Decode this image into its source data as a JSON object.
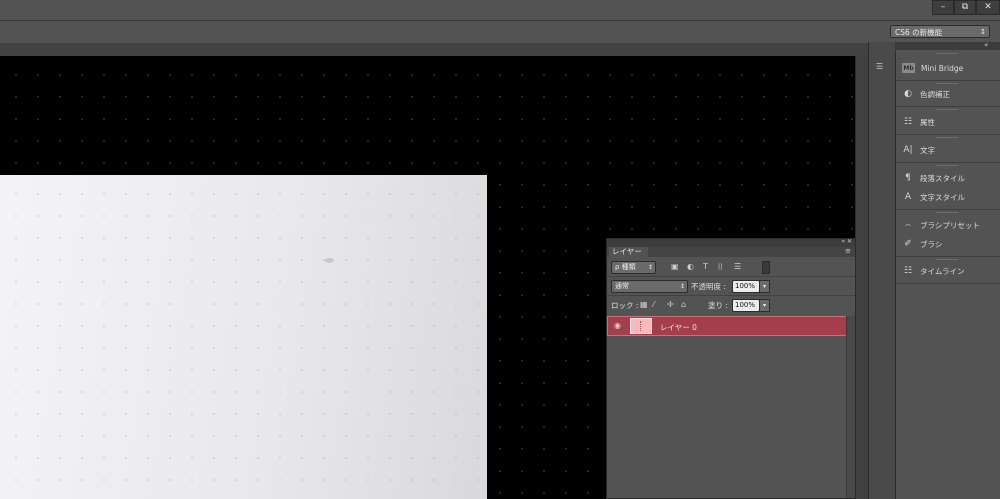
{
  "window": {
    "minimize_label": "–",
    "restore_label": "⧉",
    "close_label": "✕"
  },
  "workspace": {
    "selected": "CS6 の新機能",
    "arrow": "↕"
  },
  "dock": {
    "expand_arrows": "«",
    "history_icon": "history-icon"
  },
  "right_panel": {
    "items": [
      {
        "label": "Mini Bridge",
        "icon": "Mb"
      },
      {
        "label": "色調補正",
        "icon": "◐"
      },
      {
        "label": "属性",
        "icon": "☷"
      },
      {
        "label": "文字",
        "icon": "A|"
      },
      {
        "label": "段落スタイル",
        "icon": "¶"
      },
      {
        "label": "文字スタイル",
        "icon": "A"
      },
      {
        "label": "ブラシプリセット",
        "icon": "⌢"
      },
      {
        "label": "ブラシ",
        "icon": "✐"
      },
      {
        "label": "タイムライン",
        "icon": "☷"
      }
    ]
  },
  "layers_panel": {
    "tab_label": "レイヤー",
    "header_controls": "« ✕",
    "menu_icon": "≡",
    "filter_kind": "ρ 種類",
    "filter_icons": [
      "▣",
      "◐",
      "T",
      "⌷",
      "☰"
    ],
    "blend_mode": "通常",
    "opacity_label": "不透明度 :",
    "opacity_value": "100%",
    "lock_label": "ロック :",
    "fill_label": "塗り :",
    "fill_value": "100%",
    "layers": [
      {
        "name": "レイヤー 0",
        "visible": true,
        "selected": true
      }
    ]
  },
  "colors": {
    "selected_layer": "#a33f4c",
    "canvas": "#000000",
    "panel": "#535353"
  }
}
